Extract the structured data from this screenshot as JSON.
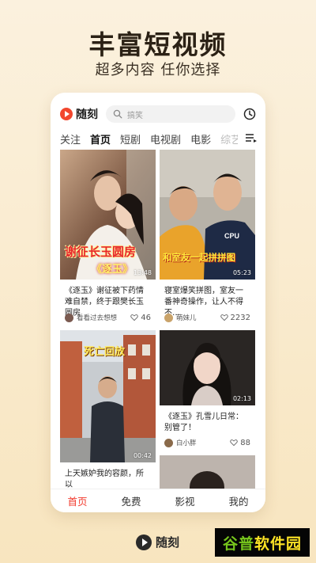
{
  "promo": {
    "headline": "丰富短视频",
    "subline": "超多内容 任你选择"
  },
  "app": {
    "name": "随刻",
    "search_placeholder": "搞笑",
    "icons": {
      "logo": "play-logo-icon",
      "search": "search-icon",
      "history": "clock-icon",
      "more_tabs": "menu-list-icon"
    },
    "colors": {
      "accent": "#f23b2e",
      "logo": "#f2472e"
    }
  },
  "tabs": [
    {
      "label": "关注",
      "active": false
    },
    {
      "label": "首页",
      "active": true
    },
    {
      "label": "短剧",
      "active": false
    },
    {
      "label": "电视剧",
      "active": false
    },
    {
      "label": "电影",
      "active": false
    },
    {
      "label": "综艺",
      "active": false
    }
  ],
  "feed": [
    {
      "title": "《逐玉》谢征被下药情难自禁，终于跟樊长玉圆房",
      "overlay_main": "谢征长玉圆房",
      "overlay_sub": "《逐玉》",
      "duration": "13:48",
      "author": "看看过去想想",
      "likes": "46"
    },
    {
      "title": "寝室爆笑拼图，室友一番神奇操作，让人不得不…",
      "overlay_main": "和室友一起拼拼图",
      "duration": "05:23",
      "author": "萌妹儿",
      "likes": "2232"
    },
    {
      "title": "上天嫉妒我的容颜，所以",
      "overlay_main": "死亡回放",
      "duration": "00:42"
    },
    {
      "title": "《逐玉》孔雪儿日常：别管了！",
      "duration": "02:13",
      "author": "白小胖",
      "likes": "88"
    }
  ],
  "bottom_nav": [
    {
      "label": "首页",
      "active": true
    },
    {
      "label": "免费",
      "active": false
    },
    {
      "label": "影视",
      "active": false
    },
    {
      "label": "我的",
      "active": false
    }
  ],
  "footer": {
    "brand": "随刻",
    "watermark_a": "谷普",
    "watermark_b": "软件园"
  }
}
